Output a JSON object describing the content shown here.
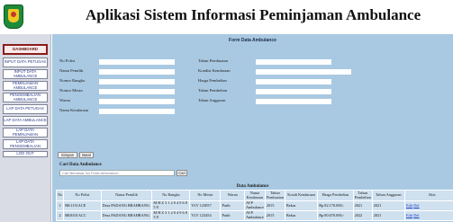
{
  "header": {
    "title": "Aplikasi Sistem Informasi Peminjaman Ambulance"
  },
  "sidebar": {
    "items": [
      {
        "label": "DASHBOARD"
      },
      {
        "label": "INPUT DATA PETUGAS"
      },
      {
        "label": "INPUT DATA AMBULANCE"
      },
      {
        "label": "PEMINJAMAN AMBULANCE"
      },
      {
        "label": "PENGEMBALIAN AMBULANCE"
      },
      {
        "label": "LAP DATA PETUGAS"
      },
      {
        "label": "LAP DATA AMBULANCE"
      },
      {
        "label": "LAP DATA PEMINJAMAN"
      },
      {
        "label": "LAP DATA PENGEMBALIAN"
      },
      {
        "label": "LOG OUT"
      }
    ]
  },
  "form": {
    "title": "Form Data Ambulance",
    "left_labels": [
      "No Polisi",
      "Nama Pemilik",
      "Nomor Rangka",
      "Nomor Mesin",
      "Warna",
      "Nama Kendaraan"
    ],
    "right_labels": [
      "Tahun Pembuatan",
      "Kondisi Kendaraan",
      "Harga Pembelian",
      "Tahun Pembelian",
      "Tahun Anggaran"
    ],
    "save_label": "Simpan",
    "reset_label": "Batal"
  },
  "search": {
    "title": "Cari Data Ambulance",
    "placeholder": "Cari Berdasar No Polisi Ambulance",
    "button_label": "Cari"
  },
  "table": {
    "title": "Data Ambulance",
    "headers": [
      "No",
      "No Polisi",
      "Nama Pemilik",
      "No Rangka",
      "No Mesin",
      "Warna",
      "Nama Kendaraan",
      "Tahun Pembuatan",
      "Kondi Kendaraan",
      "Harga Pembelian",
      "Tahun Pembelian",
      "Tahun Anggaran",
      "Aksi"
    ],
    "rows": [
      {
        "no": "1",
        "polisi": "BK1131ACE",
        "pemilik": "Desa PADANG BRAHRANG",
        "rangka": "M H Z 3 1 2 0 4 9 6 8 5 8",
        "mesin": "VLV 123057",
        "warna": "Putih",
        "kendaraan": "AVP Ambulance",
        "thn_buat": "2015",
        "kondisi": "Bekas",
        "harga": "Rp 82.170.000,-",
        "thn_beli": "2021",
        "anggaran": "2021",
        "edit": "Edit",
        "del": "Del"
      },
      {
        "no": "2",
        "polisi": "BK8101ACC",
        "pemilik": "Desa PADANG BRAHRANG",
        "rangka": "M H Z 3 1 2 0 4 9 6 8 5 8",
        "mesin": "VLV 123454",
        "warna": "Putih",
        "kendaraan": "AVP Ambulance",
        "thn_buat": "2015",
        "kondisi": "Bekas",
        "harga": "Rp 80.670.000,-",
        "thn_beli": "2022",
        "anggaran": "2021",
        "edit": "Edit",
        "del": "Del"
      }
    ]
  },
  "colors": {
    "sidebar_bg": "#d9dce4",
    "main_bg": "#a9c9e2",
    "active_border": "#8a1d1d",
    "link": "#1a3fd1"
  }
}
